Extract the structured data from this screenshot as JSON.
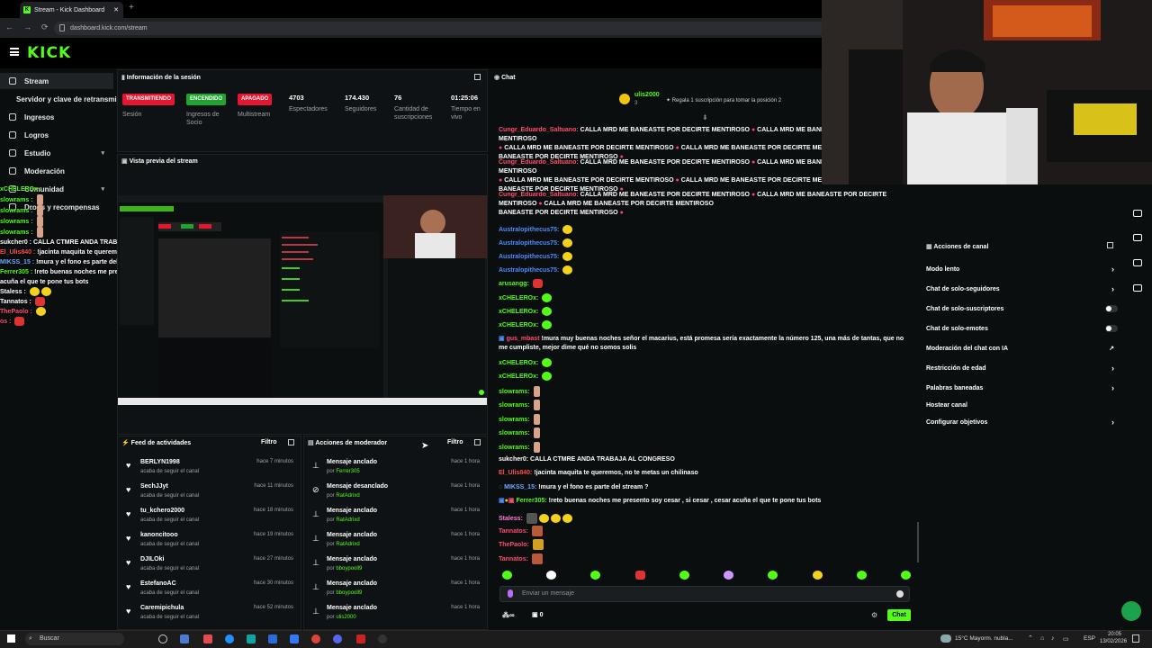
{
  "browser": {
    "tab_title": "Stream - Kick Dashboard",
    "tab_close": "✕",
    "new_tab": "+",
    "url": "dashboard.kick.com/stream",
    "nav": [
      "←",
      "→",
      "⟳"
    ]
  },
  "brand": {
    "logo": "KICK",
    "accent": "#53fc18"
  },
  "sidebar": {
    "items": [
      {
        "label": "Stream",
        "icon": "stream-icon",
        "active": true
      },
      {
        "label": "Servidor y clave de retransmisión",
        "icon": "none"
      },
      {
        "label": "Ingresos",
        "icon": "wallet-icon"
      },
      {
        "label": "Logros",
        "icon": "trophy-icon"
      },
      {
        "label": "Estudio",
        "icon": "studio-icon",
        "chevron": "▾"
      },
      {
        "label": "Moderación",
        "icon": "sword-icon"
      },
      {
        "label": "Comunidad",
        "icon": "users-icon",
        "chevron": "▾"
      },
      {
        "label": "Drops y recompensas",
        "icon": "gift-icon"
      }
    ]
  },
  "overlay_chat": [
    {
      "user": "xCHELEROx :",
      "text": ""
    },
    {
      "user": "slowrams :",
      "text": ""
    },
    {
      "user": "slowrams :",
      "text": ""
    },
    {
      "user": "slowrams :",
      "text": ""
    },
    {
      "user": "slowrams :",
      "text": ""
    },
    {
      "user": "sukcher0 :",
      "text": "CALLA CTMRE ANDA TRABAJA AL CONGRESO"
    },
    {
      "user": "El_Ulis840 :",
      "text": "!jacinta maquita te queremos, no te metas un chilinaso"
    },
    {
      "user": "MIKSS_15 :",
      "text": "!mura y el fono es parte del stream ?"
    },
    {
      "user": "Ferrer305 :",
      "text": "!reto buenas noches me presento soy cesar , si cesar , cesar"
    },
    {
      "user": "",
      "text": "acuña el que te pone tus bots"
    },
    {
      "user": "Staless :",
      "text": ""
    },
    {
      "user": "Tannatos :",
      "text": ""
    },
    {
      "user": "ThePaolo :",
      "text": ""
    },
    {
      "user": "os :",
      "text": ""
    }
  ],
  "session": {
    "title": "Información de la sesión",
    "stats": [
      {
        "value": "TRANSMITIENDO",
        "label": "Sesión",
        "pill": "#e5162f"
      },
      {
        "value": "ENCENDIDO",
        "label": "Ingresos de Socio",
        "pill": "#20a32f"
      },
      {
        "value": "APAGADO",
        "label": "Multistream",
        "pill": "#e5162f"
      },
      {
        "value": "4703",
        "label": "Espectadores"
      },
      {
        "value": "174.430",
        "label": "Seguidores"
      },
      {
        "value": "76",
        "label": "Cantidad de suscripciones"
      },
      {
        "value": "01:25:06",
        "label": "Tiempo en vivo"
      }
    ]
  },
  "preview": {
    "title": "Vista previa del stream"
  },
  "activity_feed": {
    "title": "Feed de actividades",
    "filter": "Filtro",
    "rows": [
      {
        "name": "BERLYN1998",
        "sub": "acaba de seguir el canal",
        "time": "hace 7 minutos"
      },
      {
        "name": "SechJJyt",
        "sub": "acaba de seguir el canal",
        "time": "hace 11 minutos"
      },
      {
        "name": "tu_kchero2000",
        "sub": "acaba de seguir el canal",
        "time": "hace 18 minutos"
      },
      {
        "name": "kanoncitooo",
        "sub": "acaba de seguir el canal",
        "time": "hace 19 minutos"
      },
      {
        "name": "DJILOki",
        "sub": "acaba de seguir el canal",
        "time": "hace 27 minutos"
      },
      {
        "name": "EstefanoAC",
        "sub": "acaba de seguir el canal",
        "time": "hace 30 minutos"
      },
      {
        "name": "Caremipichula",
        "sub": "acaba de seguir el canal",
        "time": "hace 52 minutos"
      }
    ]
  },
  "mod_actions": {
    "title": "Acciones de moderador",
    "filter": "Filtro",
    "rows": [
      {
        "name": "Mensaje anclado",
        "by": "Ferrer305",
        "time": "hace 1 hora"
      },
      {
        "name": "Mensaje desanclado",
        "by": "RatAdrixd",
        "time": "hace 1 hora"
      },
      {
        "name": "Mensaje anclado",
        "by": "RatAdrixd",
        "time": "hace 1 hora"
      },
      {
        "name": "Mensaje anclado",
        "by": "RatAdrixd",
        "time": "hace 1 hora"
      },
      {
        "name": "Mensaje anclado",
        "by": "bboypooll9",
        "time": "hace 1 hora"
      },
      {
        "name": "Mensaje anclado",
        "by": "bboypooll9",
        "time": "hace 1 hora"
      },
      {
        "name": "Mensaje anclado",
        "by": "ulis2000",
        "time": "hace 1 hora"
      }
    ],
    "by_prefix": "por "
  },
  "chat": {
    "title": "Chat",
    "gift_user": "ulis2000",
    "gift_count": "3",
    "gift_text": "Regala 1 suscripción para tomar la posición 2",
    "spam_user": "Cungr_Eduardo_Saltuano:",
    "spam_text_a": "CALLA MRD ME BANEASTE POR DECIRTE MENTIROSO",
    "spam_text_b": "CALLA MRD ME BANEASTE POR DECIRTE MENTIROSO",
    "spam_text_c": "BANEASTE POR DECIRTE MENTIROSO",
    "spam_prefix": "CALLA MRD ME BANEASTE POR DECIRTE MENTIROSO",
    "spam_suffix": "CALLA MRD ME BANEASTE POR DECIRTE MENTIROSO",
    "spam_end": "CALLA MRD ME BANEASTE POR DECIRTE MENTIROSO",
    "austral_user": "Australopithecus75:",
    "arusangg_user": "arusangg:",
    "xchelero_user": "xCHELEROx:",
    "mod_user": "gus_mbast",
    "mod_text": "!mura muy buenas noches señor el macarius, está promesa sería exactamente la número 125, una más de tantas, que no me cumpliste, mejor dime qué no somos solis",
    "slowrams_user": "slowrams:",
    "sukcher_user": "sukcher0:",
    "sukcher_text": "CALLA CTMRE ANDA TRABAJA AL CONGRESO",
    "elulis_user": "El_Ulis840:",
    "elulis_text": "!jacinta maquita te queremos, no te metas un chilinaso",
    "mikss_user": "MIKSS_15:",
    "mikss_text": "!mura y el fono es parte del stream ?",
    "ferrer_user": "Ferrer305:",
    "ferrer_text": "!reto buenas noches me presento soy cesar , si cesar , cesar acuña el que te pone tus bots",
    "staless_user": "Staless:",
    "tannatos_user": "Tannatos:",
    "thepaolo_user": "ThePaolo:",
    "input_placeholder": "Enviar un mensaje",
    "send_label": "Chat",
    "infinity": "∞",
    "count": "0"
  },
  "channel_actions": {
    "title": "Acciones de canal",
    "items": [
      {
        "label": "Modo lento",
        "control": "chevron"
      },
      {
        "label": "Chat de solo-seguidores",
        "control": "chevron"
      },
      {
        "label": "Chat de solo-suscriptores",
        "control": "toggle"
      },
      {
        "label": "Chat de solo-emotes",
        "control": "toggle"
      },
      {
        "label": "Moderación del chat con IA",
        "control": "external"
      },
      {
        "label": "Restricción de edad",
        "control": "chevron"
      },
      {
        "label": "Palabras baneadas",
        "control": "chevron"
      },
      {
        "label": "Hostear canal",
        "control": "none"
      },
      {
        "label": "Configurar objetivos",
        "control": "chevron"
      }
    ]
  },
  "taskbar": {
    "search": "Buscar",
    "weather": "15°C  Mayorm. nubla...",
    "lang": "ESP",
    "time": "20:05",
    "date": "13/02/2026"
  }
}
